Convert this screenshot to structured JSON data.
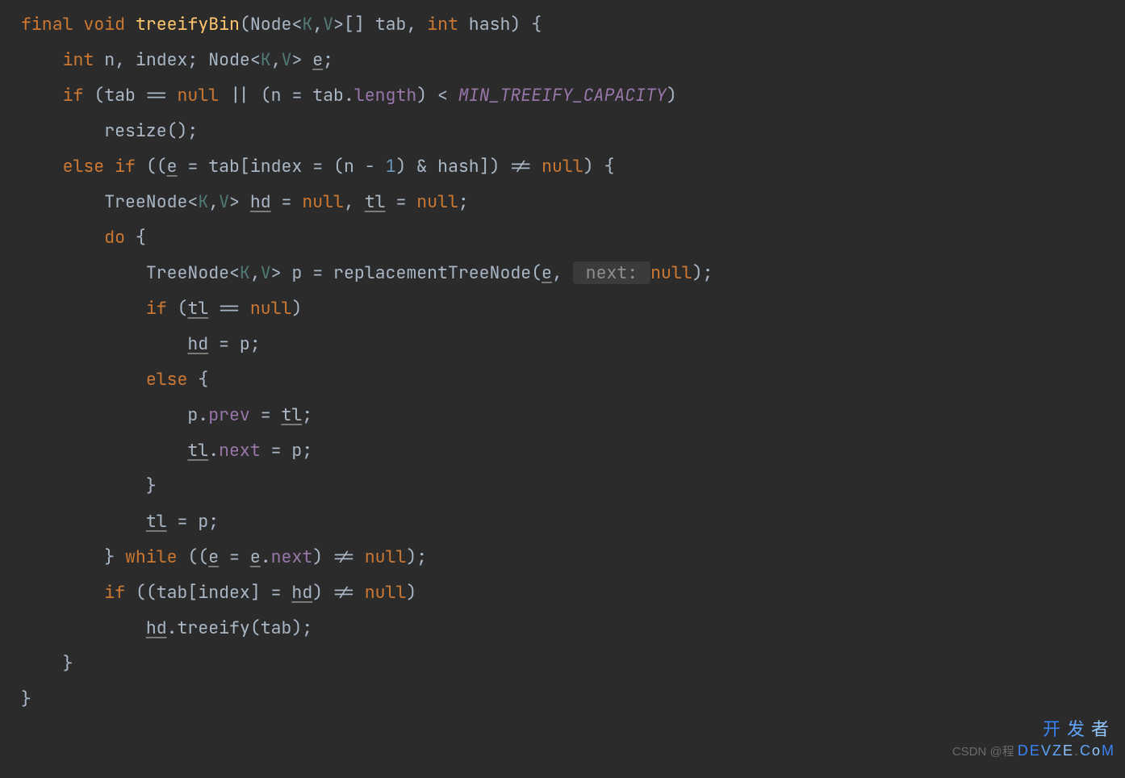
{
  "code": {
    "l1": {
      "kw1": "final",
      "kw2": "void",
      "method": "treeifyBin",
      "type1": "Node",
      "tp1": "K",
      "tp2": "V",
      "arr": "[] tab, ",
      "kw3": "int",
      "param2": " hash) {"
    },
    "l2": {
      "kw1": "int",
      "rest": " n, index; ",
      "type": "Node",
      "tp1": "K",
      "tp2": "V",
      "gt": "> ",
      "var": "e",
      "semi": ";"
    },
    "l3": {
      "kw": "if",
      "rest1": " (tab == ",
      "null1": "null",
      "rest2": " || (n = tab.",
      "field": "length",
      "rest3": ") < ",
      "const": "MIN_TREEIFY_CAPACITY",
      "rest4": ")"
    },
    "l4": {
      "call": "resize",
      "rest": "();"
    },
    "l5": {
      "kw1": "else",
      "kw2": "if",
      "rest1": " ((",
      "v1": "e",
      "rest2": " = tab[index = (n - ",
      "num": "1",
      "rest3": ") & hash]) != ",
      "null": "null",
      "rest4": ") {"
    },
    "l6": {
      "type": "TreeNode",
      "tp1": "K",
      "tp2": "V",
      "gt": "> ",
      "v1": "hd",
      "rest1": " = ",
      "null1": "null",
      "rest2": ", ",
      "v2": "tl",
      "rest3": " = ",
      "null2": "null",
      "semi": ";"
    },
    "l7": {
      "kw": "do",
      "brace": " {"
    },
    "l8": {
      "type": "TreeNode",
      "tp1": "K",
      "tp2": "V",
      "rest1": "> p = replacementTreeNode(",
      "v1": "e",
      "comma": ", ",
      "hint": " next: ",
      "null": "null",
      "rest2": ");"
    },
    "l9": {
      "kw": "if",
      "rest1": " (",
      "v1": "tl",
      "rest2": " == ",
      "null": "null",
      "rest3": ")"
    },
    "l10": {
      "v1": "hd",
      "rest": " = p;"
    },
    "l11": {
      "kw": "else",
      "brace": " {"
    },
    "l12": {
      "rest1": "p.",
      "field": "prev",
      "rest2": " = ",
      "v1": "tl",
      "semi": ";"
    },
    "l13": {
      "v1": "tl",
      "dot": ".",
      "field": "next",
      "rest": " = p;"
    },
    "l14": {
      "brace": "}"
    },
    "l15": {
      "v1": "tl",
      "rest": " = p;"
    },
    "l16": {
      "brace": "} ",
      "kw": "while",
      "rest1": " ((",
      "v1": "e",
      "rest2": " = ",
      "v2": "e",
      "dot": ".",
      "field": "next",
      "rest3": ") != ",
      "null": "null",
      "rest4": ");"
    },
    "l17": {
      "kw": "if",
      "rest1": " ((tab[index] = ",
      "v1": "hd",
      "rest2": ") != ",
      "null": "null",
      "rest3": ")"
    },
    "l18": {
      "v1": "hd",
      "dot": ".",
      "method": "treeify",
      "rest": "(tab);"
    },
    "l19": {
      "brace": "}"
    },
    "l20": {
      "brace": "}"
    }
  },
  "watermark": {
    "csdn": "CSDN @程",
    "brand1": "D",
    "brand2": "E",
    "brand3": "V",
    "brand4": "Z",
    "brand5": "E",
    "dot": ".",
    "brand6": "C",
    "brand7": "o",
    "brand8": "M",
    "cjk": "开 发 者"
  }
}
